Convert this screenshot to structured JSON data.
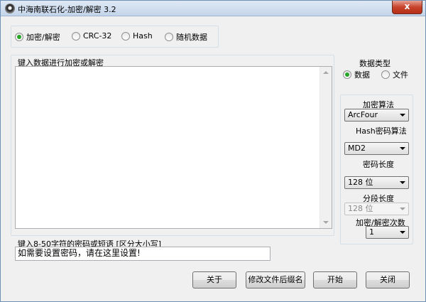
{
  "window": {
    "title": "中海南联石化-加密/解密 3.2",
    "close_glyph": "x"
  },
  "mode_group": {
    "options": [
      {
        "label": "加密/解密",
        "selected": true
      },
      {
        "label": "CRC-32",
        "selected": false
      },
      {
        "label": "Hash",
        "selected": false
      },
      {
        "label": "随机数据",
        "selected": false
      }
    ]
  },
  "input_area": {
    "label": "键入数据进行加密或解密",
    "value": ""
  },
  "data_type": {
    "title": "数据类型",
    "options": [
      {
        "label": "数据",
        "selected": true
      },
      {
        "label": "文件",
        "selected": false
      }
    ]
  },
  "settings": {
    "algorithm_label": "加密算法",
    "algorithm_value": "ArcFour",
    "hash_label": "Hash密码算法",
    "hash_value": "MD2",
    "key_length_label": "密码长度",
    "key_length_value": "128 位",
    "segment_length_label": "分段长度",
    "segment_length_value": "128 位",
    "rounds_label": "加密/解密次数",
    "rounds_value": "1"
  },
  "password": {
    "label": "键入8-50字符的密码或短语 [区分大小写]",
    "value": "如需要设置密码，请在这里设置!"
  },
  "buttons": {
    "about": "关于",
    "rename": "修改文件后缀名",
    "start": "开始",
    "close": "关闭"
  },
  "colors": {
    "radio_selected": "#26a526",
    "titlebar": "#c4d5ea",
    "close_button": "#c7432b"
  }
}
